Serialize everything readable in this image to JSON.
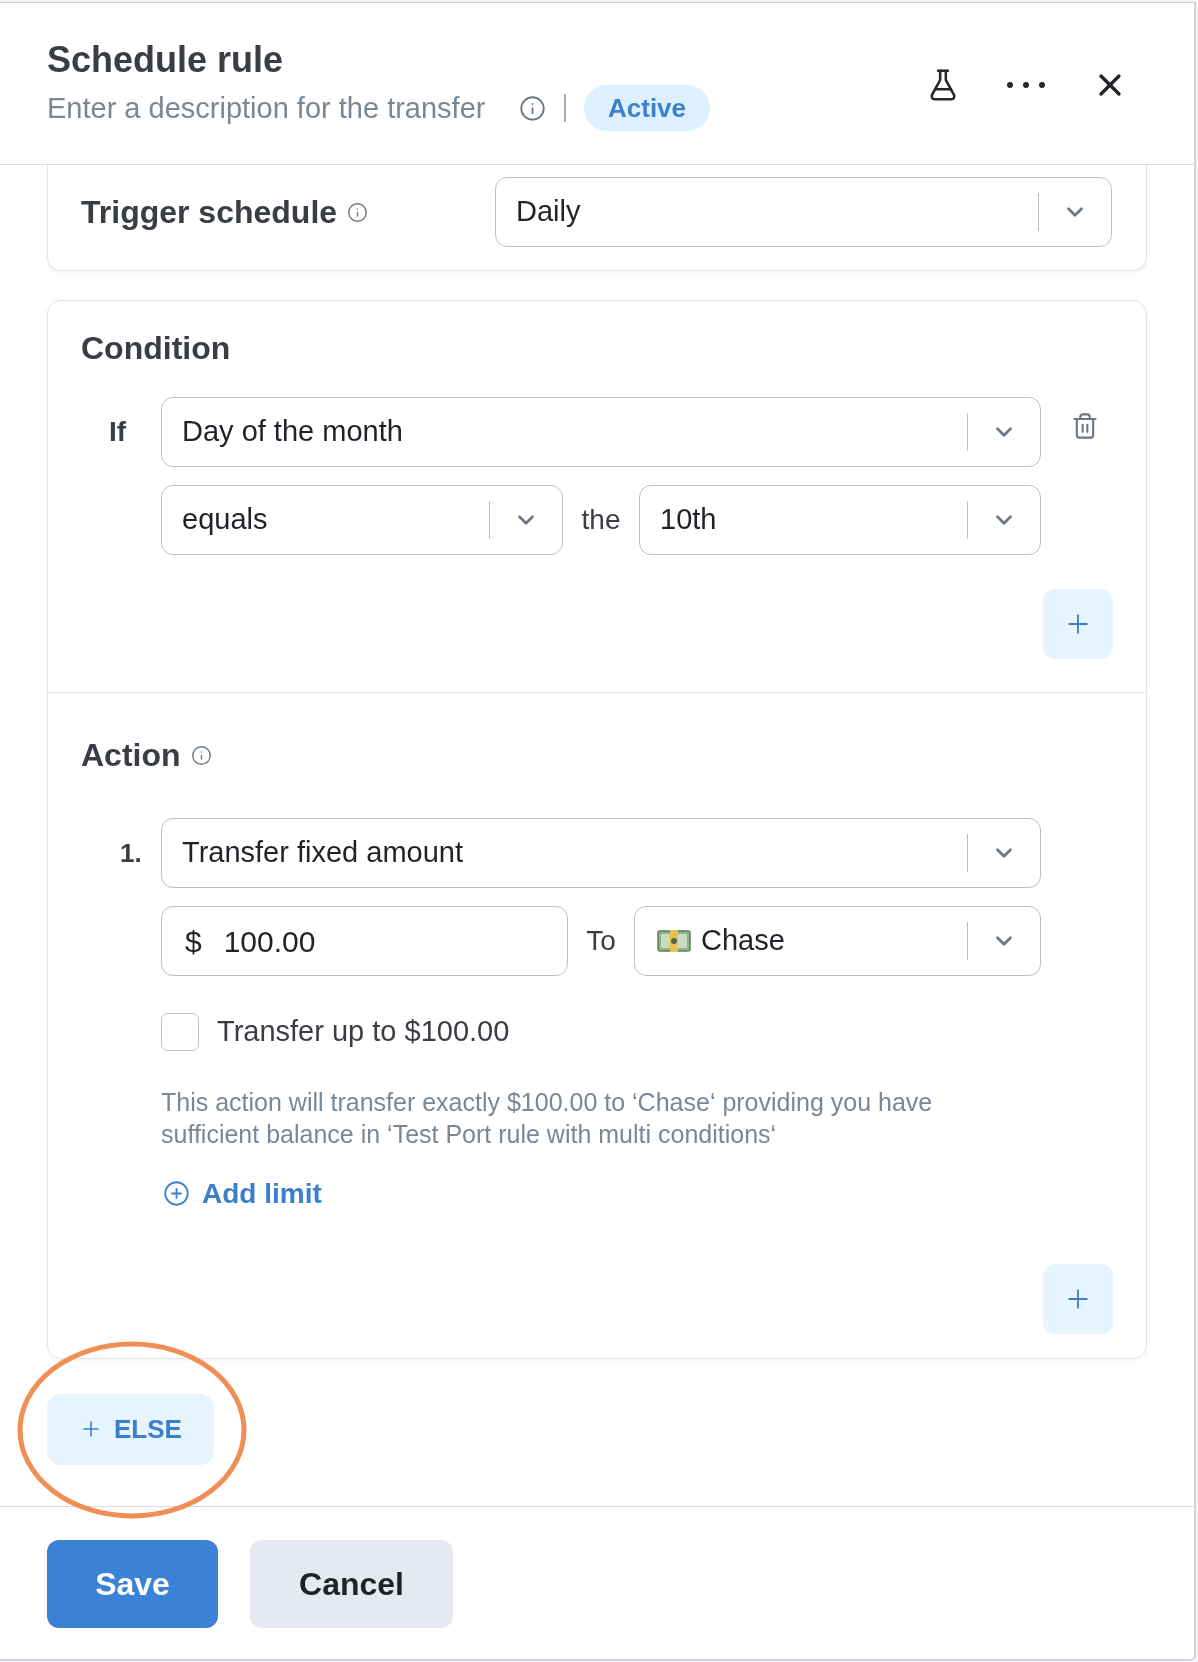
{
  "header": {
    "title": "Schedule rule",
    "description": {
      "placeholder": "Enter a description for the transfer"
    },
    "status_badge": "Active"
  },
  "trigger": {
    "label": "Trigger schedule",
    "value": "Daily"
  },
  "condition": {
    "title": "Condition",
    "rows": [
      {
        "label": "If",
        "field": "Day of the month",
        "operator": "equals",
        "connector": "the",
        "value": "10th"
      }
    ]
  },
  "action": {
    "title": "Action",
    "steps": [
      {
        "number": "1.",
        "type": "Transfer fixed amount",
        "currency": "$",
        "amount": "100.00",
        "to_label": "To",
        "destination": "Chase",
        "cap": {
          "label": "Transfer up to $100.00",
          "checked": false
        },
        "summary": "This action will transfer exactly $100.00 to ‘Chase‘ providing you have sufficient balance in ‘Test Port rule with multi conditions‘",
        "add_limit": "Add limit"
      }
    ]
  },
  "else_button": {
    "label": "ELSE",
    "highlighted": true
  },
  "footer": {
    "buttons": [
      {
        "label": "Save",
        "kind": "primary"
      },
      {
        "label": "Cancel",
        "kind": "secondary"
      }
    ]
  }
}
